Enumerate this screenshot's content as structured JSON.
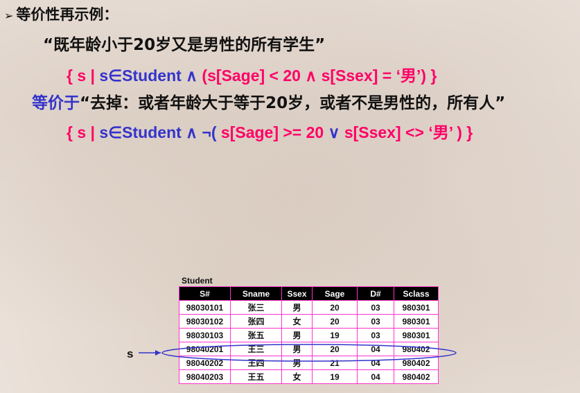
{
  "slide": {
    "line1": {
      "bullet": "➢",
      "text": "等价性再示例："
    },
    "line2": "“既年龄小于20岁又是男性的所有学生”",
    "line3": {
      "open": "{ s | ",
      "var_in": "s∈Student",
      "and": " ∧ ",
      "cond": "(s[Sage] < 20 ∧ s[Ssex] = ‘男’)",
      "close": " }"
    },
    "line4": {
      "keyword": "等价于",
      "text": "“去掉：或者年龄大于等于20岁，或者不是男性的，所有人”"
    },
    "line5": {
      "open": "{ s | ",
      "var_in": "s∈Student",
      "and_not": " ∧ ¬( ",
      "cond1": "s[Sage] >= 20",
      "or": " ∨ ",
      "cond2": "s[Ssex] <> ‘男’",
      "close": " ) }"
    }
  },
  "table": {
    "caption": "Student",
    "headers": [
      "S#",
      "Sname",
      "Ssex",
      "Sage",
      "D#",
      "Sclass"
    ],
    "rows": [
      [
        "98030101",
        "张三",
        "男",
        "20",
        "03",
        "980301"
      ],
      [
        "98030102",
        "张四",
        "女",
        "20",
        "03",
        "980301"
      ],
      [
        "98030103",
        "张五",
        "男",
        "19",
        "03",
        "980301"
      ],
      [
        "98040201",
        "王三",
        "男",
        "20",
        "04",
        "980402"
      ],
      [
        "98040202",
        "王四",
        "男",
        "21",
        "04",
        "980402"
      ],
      [
        "98040203",
        "王五",
        "女",
        "19",
        "04",
        "980402"
      ]
    ],
    "highlighted_row": 3
  },
  "pointer_label": "s",
  "colors": {
    "pink": "#ff0066",
    "blue": "#3333cc",
    "table_border": "#ff33cc",
    "ellipse": "#3333cc"
  }
}
